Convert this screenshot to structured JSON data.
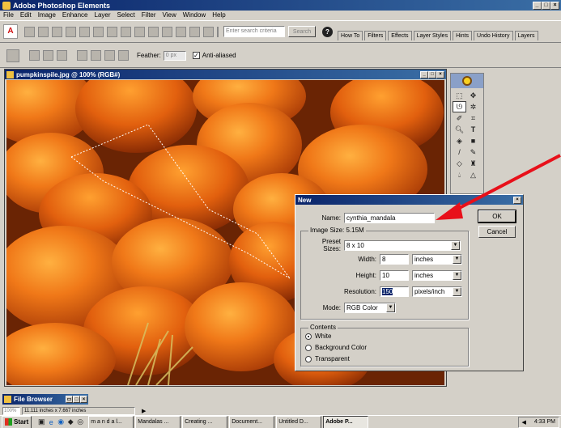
{
  "app": {
    "title": "Adobe Photoshop Elements",
    "window_controls": [
      "_",
      "□",
      "×"
    ]
  },
  "menu": [
    "File",
    "Edit",
    "Image",
    "Enhance",
    "Layer",
    "Select",
    "Filter",
    "View",
    "Window",
    "Help"
  ],
  "toolbar": {
    "search_placeholder": "Enter search criteria",
    "search_button": "Search",
    "help_icon": "?"
  },
  "palette_tabs": [
    "How To",
    "Filters",
    "Effects",
    "Layer Styles",
    "Hints",
    "Undo History",
    "Layers"
  ],
  "options_bar": {
    "feather_label": "Feather:",
    "feather_value": "0 px",
    "antialiased_label": "Anti-aliased"
  },
  "document": {
    "title": "pumpkinspile.jpg @ 100% (RGB#)"
  },
  "new_dialog": {
    "title": "New",
    "name_label": "Name:",
    "name_value": "cynthia_mandala",
    "ok": "OK",
    "cancel": "Cancel",
    "image_size_label": "Image Size: 5.15M",
    "preset_label": "Preset Sizes:",
    "preset_value": "8 x 10",
    "width_label": "Width:",
    "width_value": "8",
    "width_unit": "inches",
    "height_label": "Height:",
    "height_value": "10",
    "height_unit": "inches",
    "resolution_label": "Resolution:",
    "resolution_value": "150",
    "resolution_unit": "pixels/inch",
    "mode_label": "Mode:",
    "mode_value": "RGB Color",
    "contents_label": "Contents",
    "contents_options": [
      "White",
      "Background Color",
      "Transparent"
    ],
    "contents_selected": "White"
  },
  "file_browser": {
    "title": "File Browser"
  },
  "status": {
    "zoom": "100%",
    "size": "11.111 inches x 7.667 inches"
  },
  "taskbar": {
    "start": "Start",
    "items": [
      "m a n d a l...",
      "Mandalas ...",
      "Creating ...",
      "Document...",
      "Untitled D...",
      "Adobe P..."
    ],
    "clock": "4:33 PM"
  },
  "colors": {
    "title_blue": "#0a246a",
    "arrow_red": "#e8101a",
    "pumpkin": "#e8681a"
  }
}
